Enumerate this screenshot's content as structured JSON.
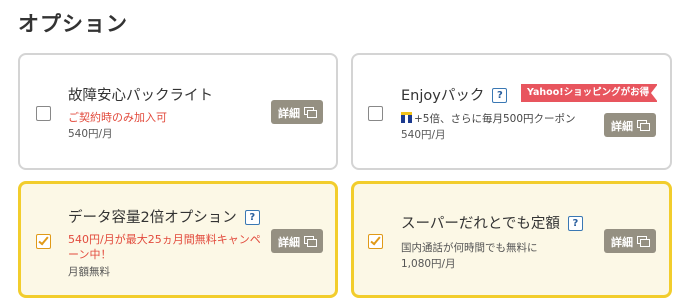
{
  "page": {
    "title": "オプション"
  },
  "options": [
    {
      "name": "故障安心パックライト",
      "note": "ご契約時のみ加入可",
      "price": "540円/月",
      "detail_label": "詳細",
      "checked": false
    },
    {
      "name": "Enjoyパック",
      "help": "?",
      "badge": "Yahoo!ショッピングがお得",
      "note": "+5倍、さらに毎月500円クーポン",
      "price": "540円/月",
      "detail_label": "詳細",
      "checked": false
    },
    {
      "name": "データ容量2倍オプション",
      "help": "?",
      "note_line1": "540円/月が最大25ヵ月間無料キャンペ",
      "note_line2": "ーン中！",
      "price": "月額無料",
      "detail_label": "詳細",
      "checked": true
    },
    {
      "name": "スーパーだれとでも定額",
      "help": "?",
      "note": "国内通話が何時間でも無料に",
      "price": "1,080円/月",
      "detail_label": "詳細",
      "checked": true
    }
  ],
  "colors": {
    "selected_border": "#f2cd2c",
    "selected_bg": "#fcf8e6",
    "accent_red": "#e24a3c",
    "detail_button": "#959082",
    "badge": "#e8555e"
  }
}
